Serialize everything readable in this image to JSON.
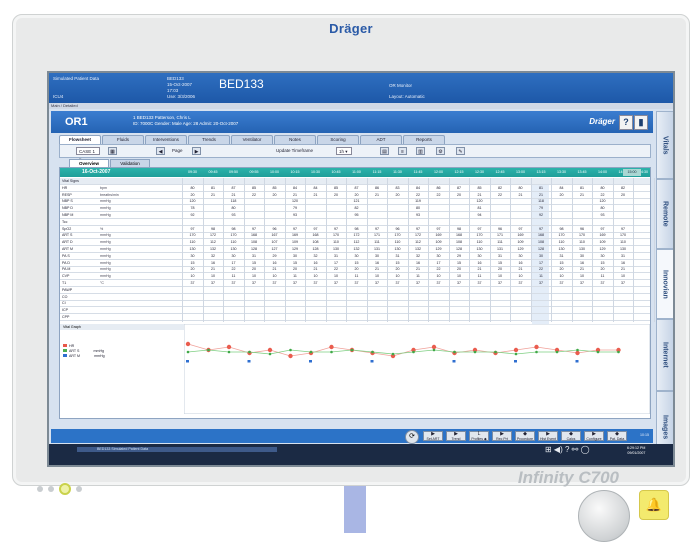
{
  "device": {
    "brand": "Dräger",
    "model": "Infinity C700"
  },
  "screen": {
    "topbar": {
      "patient_data": "Simulated Patient Data",
      "unit": "ICU4",
      "bed_small": "BED133",
      "date": "15-Oct-2007",
      "time": "17:03",
      "bed": "BED133",
      "note": "Use: 3/3/2006",
      "system": "OR Monitor",
      "layout": "Layout: Automatic"
    },
    "subbar": "Main / Detailed",
    "patient_header": {
      "location": "OR1",
      "name_line": "1 BED133 Patterson, Chris L",
      "detail_line": "ID: 7000C    Gender: Male    Age: 28    Admit: 20-Oct-2007",
      "logo": "Dräger",
      "help": "?",
      "print": "▮"
    },
    "tabs": [
      "Flowsheet",
      "Fluids",
      "Interventions",
      "Trends",
      "Ventilator",
      "Notes",
      "Scoring",
      "ADT",
      "Reports"
    ],
    "toolbar": {
      "cases_label": "CASE 1 ▾",
      "page_label": "Page",
      "update_label": "Update Timeframe",
      "update_value": "1h ▾"
    },
    "subtabs": [
      "Overview",
      "Validation"
    ],
    "flowsheet": {
      "date": "16-Oct-2007",
      "times": [
        "09:30",
        "09:45",
        "09:50",
        "09:55",
        "10:00",
        "10:15",
        "10:30",
        "10:45",
        "11:00",
        "11:15",
        "11:30",
        "11:45",
        "12:00",
        "12:15",
        "12:30",
        "12:45",
        "13:00",
        "13:15",
        "13:30",
        "13:45",
        "14:00",
        "14:15",
        "14:30"
      ],
      "last_col": "15:00",
      "rows": [
        {
          "label": "Vital Signs",
          "unit": "",
          "section": true,
          "values": []
        },
        {
          "label": "HR",
          "unit": "bpm",
          "values": [
            "80",
            "81",
            "87",
            "85",
            "85",
            "84",
            "84",
            "85",
            "87",
            "86",
            "83",
            "84",
            "86",
            "87",
            "85",
            "82",
            "80",
            "81",
            "84",
            "81",
            "80",
            "82"
          ]
        },
        {
          "label": "RESP",
          "unit": "breaths/min",
          "values": [
            "20",
            "21",
            "21",
            "22",
            "20",
            "21",
            "21",
            "20",
            "20",
            "21",
            "20",
            "22",
            "22",
            "20",
            "21",
            "22",
            "21",
            "21",
            "20",
            "21",
            "22",
            "20"
          ]
        },
        {
          "label": "NBP S",
          "unit": "mmHg",
          "values": [
            "120",
            "",
            "118",
            "",
            "",
            "120",
            "",
            "",
            "121",
            "",
            "",
            "119",
            "",
            "",
            "120",
            "",
            "",
            "118",
            "",
            "",
            "120",
            ""
          ]
        },
        {
          "label": "NBP D",
          "unit": "mmHg",
          "values": [
            "78",
            "",
            "80",
            "",
            "",
            "79",
            "",
            "",
            "82",
            "",
            "",
            "80",
            "",
            "",
            "81",
            "",
            "",
            "79",
            "",
            "",
            "80",
            ""
          ]
        },
        {
          "label": "NBP M",
          "unit": "mmHg",
          "values": [
            "92",
            "",
            "93",
            "",
            "",
            "93",
            "",
            "",
            "95",
            "",
            "",
            "93",
            "",
            "",
            "94",
            "",
            "",
            "92",
            "",
            "",
            "93",
            ""
          ]
        },
        {
          "label": "Tcc",
          "unit": "",
          "values": []
        },
        {
          "label": "SpO2",
          "unit": "%",
          "values": [
            "97",
            "98",
            "98",
            "97",
            "96",
            "97",
            "97",
            "97",
            "98",
            "97",
            "96",
            "97",
            "97",
            "98",
            "97",
            "96",
            "97",
            "97",
            "98",
            "96",
            "97",
            "97"
          ]
        },
        {
          "label": "ART S",
          "unit": "mmHg",
          "values": [
            "170",
            "172",
            "170",
            "168",
            "167",
            "169",
            "168",
            "170",
            "172",
            "171",
            "170",
            "172",
            "169",
            "168",
            "170",
            "171",
            "169",
            "168",
            "170",
            "170",
            "169",
            "170"
          ]
        },
        {
          "label": "ART D",
          "unit": "mmHg",
          "values": [
            "110",
            "112",
            "110",
            "108",
            "107",
            "109",
            "108",
            "110",
            "112",
            "111",
            "110",
            "112",
            "109",
            "108",
            "110",
            "111",
            "109",
            "108",
            "110",
            "110",
            "109",
            "110"
          ]
        },
        {
          "label": "ART M",
          "unit": "mmHg",
          "values": [
            "130",
            "132",
            "130",
            "128",
            "127",
            "129",
            "128",
            "130",
            "132",
            "131",
            "130",
            "132",
            "129",
            "128",
            "130",
            "131",
            "129",
            "128",
            "130",
            "130",
            "129",
            "130"
          ]
        },
        {
          "label": "PA S",
          "unit": "mmHg",
          "values": [
            "30",
            "32",
            "30",
            "31",
            "29",
            "30",
            "32",
            "31",
            "30",
            "30",
            "31",
            "32",
            "30",
            "29",
            "30",
            "31",
            "30",
            "30",
            "31",
            "30",
            "30",
            "31"
          ]
        },
        {
          "label": "PA D",
          "unit": "mmHg",
          "values": [
            "15",
            "16",
            "17",
            "15",
            "16",
            "15",
            "16",
            "17",
            "15",
            "16",
            "15",
            "16",
            "17",
            "15",
            "16",
            "15",
            "16",
            "17",
            "15",
            "16",
            "15",
            "16"
          ]
        },
        {
          "label": "PA M",
          "unit": "mmHg",
          "values": [
            "20",
            "21",
            "22",
            "20",
            "21",
            "20",
            "21",
            "22",
            "20",
            "21",
            "20",
            "21",
            "22",
            "20",
            "21",
            "20",
            "21",
            "22",
            "20",
            "21",
            "20",
            "21"
          ]
        },
        {
          "label": "CVP",
          "unit": "mmHg",
          "values": [
            "10",
            "10",
            "11",
            "10",
            "10",
            "11",
            "10",
            "10",
            "11",
            "10",
            "10",
            "11",
            "10",
            "10",
            "11",
            "10",
            "10",
            "11",
            "10",
            "10",
            "11",
            "10"
          ]
        },
        {
          "label": "T1",
          "unit": "°C",
          "values": [
            "37",
            "37",
            "37",
            "37",
            "37",
            "37",
            "37",
            "37",
            "37",
            "37",
            "37",
            "37",
            "37",
            "37",
            "37",
            "37",
            "37",
            "37",
            "37",
            "37",
            "37",
            "37"
          ]
        },
        {
          "label": "PAWP",
          "unit": "",
          "values": []
        },
        {
          "label": "CO",
          "unit": "",
          "values": []
        },
        {
          "label": "CI",
          "unit": "",
          "values": []
        },
        {
          "label": "ICP",
          "unit": "",
          "values": []
        },
        {
          "label": "CPP",
          "unit": "",
          "values": []
        }
      ]
    },
    "graph": {
      "title": "Vital Graph",
      "legend": [
        {
          "label": "HR",
          "unit": "",
          "color": "#e8584a"
        },
        {
          "label": "ART S",
          "unit": "mmHg",
          "color": "#4caf50"
        },
        {
          "label": "ART M",
          "unit": "mmHg",
          "color": "#2f6fd0"
        }
      ]
    },
    "function_keys": [
      {
        "sym": "▶",
        "label": "Set ART"
      },
      {
        "sym": "▶",
        "label": "Trend"
      },
      {
        "sym": "L",
        "label": "Profiles ◆"
      },
      {
        "sym": "▶",
        "label": "Rec Prt"
      },
      {
        "sym": "◆",
        "label": "Procedure"
      },
      {
        "sym": "▶",
        "label": "Hist Event"
      },
      {
        "sym": "◆",
        "label": "Calcs"
      },
      {
        "sym": "▶",
        "label": "Configure"
      },
      {
        "sym": "◆",
        "label": "Pat. Data"
      }
    ],
    "bottom_right": "10:15",
    "status": {
      "left": "BED133 Simulated Patient Data",
      "icons": "⊞ ◀) ? ⚯ ◯",
      "clock_time": "6:29:12 PM",
      "clock_date": "09/01/2007"
    },
    "right_tabs": [
      "Vitals",
      "Remote",
      "Innovian",
      "Internet",
      "Images"
    ],
    "graph_series": {
      "hr": [
        82,
        80,
        81,
        79,
        80,
        78,
        79,
        81,
        80,
        79,
        78,
        80,
        81,
        79,
        80,
        79,
        80,
        81,
        80,
        79,
        80,
        80
      ],
      "art": [
        70,
        71,
        70,
        70,
        69,
        71,
        70,
        70,
        71,
        70,
        69,
        70,
        71,
        70,
        70,
        70,
        69,
        70,
        70,
        71,
        70,
        70
      ]
    }
  }
}
